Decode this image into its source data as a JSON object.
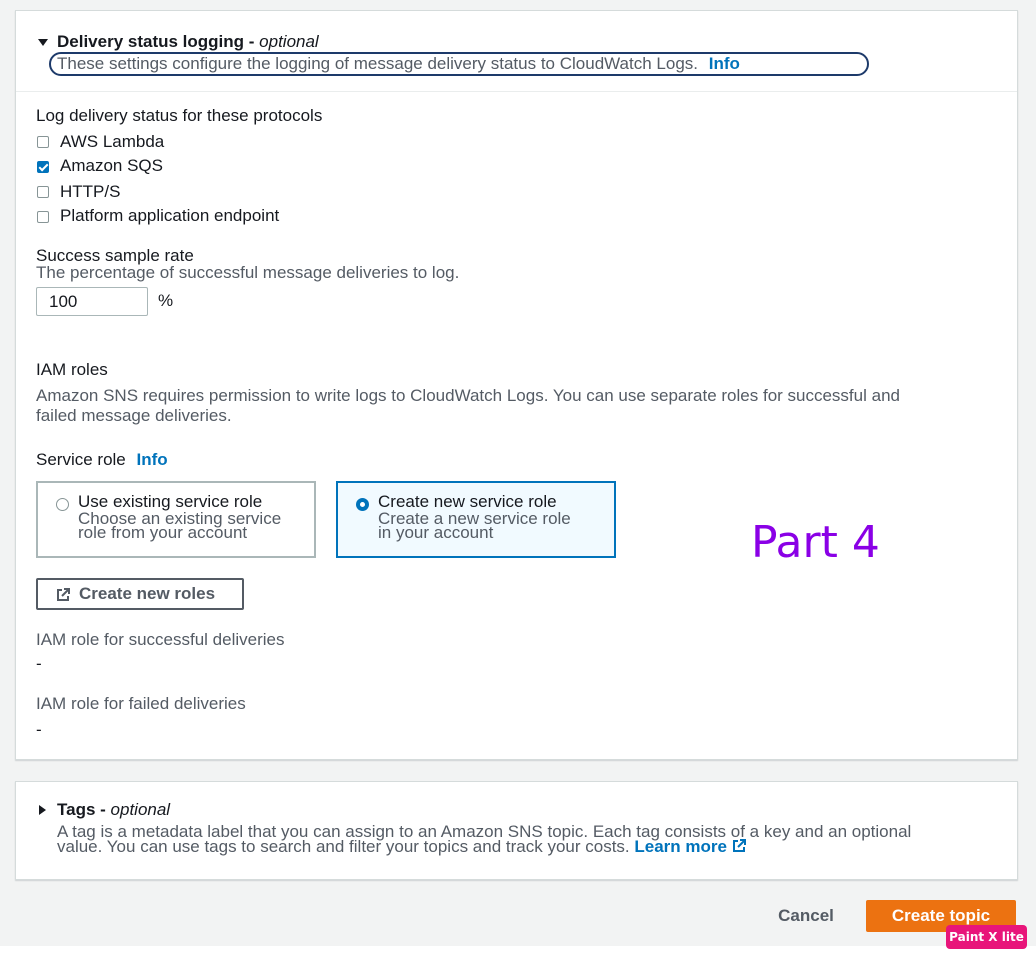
{
  "delivery_section": {
    "title": "Delivery status logging",
    "title_suffix": "optional",
    "description": "These settings configure the logging of message delivery status to CloudWatch Logs.",
    "info_label": "Info"
  },
  "protocols": {
    "label": "Log delivery status for these protocols",
    "items": [
      {
        "label": "AWS Lambda",
        "checked": false
      },
      {
        "label": "Amazon SQS",
        "checked": true
      },
      {
        "label": "HTTP/S",
        "checked": false
      },
      {
        "label": "Platform application endpoint",
        "checked": false
      }
    ]
  },
  "sample_rate": {
    "label": "Success sample rate",
    "description": "The percentage of successful message deliveries to log.",
    "value": "100",
    "unit": "%"
  },
  "iam_roles": {
    "label": "IAM roles",
    "description_line1": "Amazon SNS requires permission to write logs to CloudWatch Logs. You can use separate roles for successful and",
    "description_line2": "failed message deliveries."
  },
  "service_role": {
    "label": "Service role",
    "info_label": "Info",
    "options": [
      {
        "title": "Use existing service role",
        "desc_line1": "Choose an existing service",
        "desc_line2": "role from your account",
        "selected": false
      },
      {
        "title": "Create new service role",
        "desc_line1": "Create a new service role",
        "desc_line2": "in your account",
        "selected": true
      }
    ]
  },
  "create_roles_button": "Create new roles",
  "role_success": {
    "label": "IAM role for successful deliveries",
    "value": "-"
  },
  "role_failed": {
    "label": "IAM role for failed deliveries",
    "value": "-"
  },
  "tags_section": {
    "title": "Tags",
    "title_suffix": "optional",
    "description_line1": "A tag is a metadata label that you can assign to an Amazon SNS topic. Each tag consists of a key and an optional",
    "description_line2": "value. You can use tags to search and filter your topics and track your costs.",
    "learn_more": "Learn more"
  },
  "footer": {
    "cancel": "Cancel",
    "create": "Create topic"
  },
  "annotation": "Part 4",
  "watermark": "Paint X lite",
  "colors": {
    "link": "#0073bb",
    "primary_button": "#ec7211",
    "annotation": "#8a00e6",
    "watermark": "#e8157a"
  }
}
